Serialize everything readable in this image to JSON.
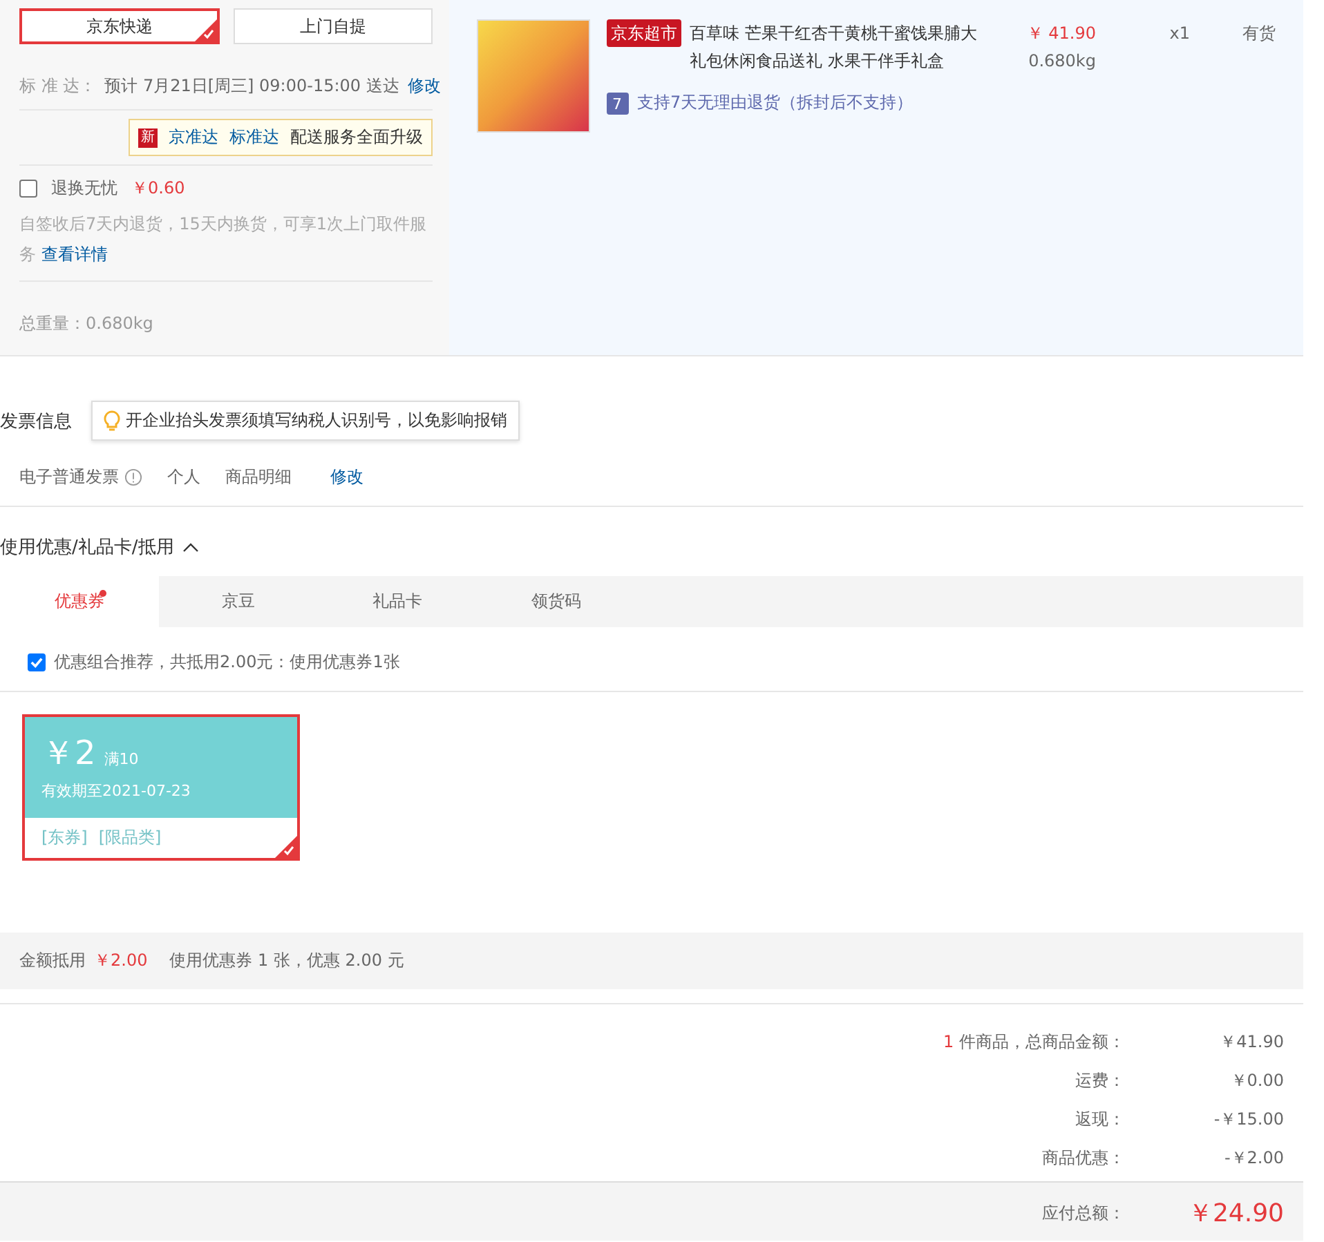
{
  "shipping": {
    "methods": [
      {
        "label": "京东快递",
        "selected": true
      },
      {
        "label": "上门自提",
        "selected": false
      }
    ],
    "delivery": {
      "label": "标 准 达：",
      "value": "预计 7月21日[周三] 09:00-15:00 送达",
      "action": "修改"
    },
    "promo": {
      "badge": "新",
      "links": [
        "京准达",
        "标准达"
      ],
      "text": "配送服务全面升级"
    },
    "addon": {
      "label": "退换无忧",
      "price": "￥0.60",
      "checked": false,
      "description": "自签收后7天内退货，15天内换货，可享1次上门取件服务",
      "link": "查看详情"
    },
    "weight": {
      "label": "总重量：",
      "value": "0.680kg"
    }
  },
  "product": {
    "tag": "京东超市",
    "title": "百草味 芒果干红杏干黄桃干蜜饯果脯大礼包休闲食品送礼 水果干伴手礼盒",
    "price": "￥ 41.90",
    "weight": "0.680kg",
    "quantity": "x1",
    "stock": "有货",
    "return_badge": "7",
    "return_policy": "支持7天无理由退货（拆封后不支持）"
  },
  "invoice": {
    "title": "发票信息",
    "tip": "开企业抬头发票须填写纳税人识别号，以免影响报销",
    "type": "电子普通发票",
    "holder": "个人",
    "content": "商品明细",
    "action": "修改"
  },
  "discounts": {
    "title": "使用优惠/礼品卡/抵用",
    "expanded": true,
    "tabs": [
      {
        "label": "优惠券",
        "selected": true,
        "dot": true
      },
      {
        "label": "京豆",
        "selected": false,
        "dot": false
      },
      {
        "label": "礼品卡",
        "selected": false,
        "dot": false
      },
      {
        "label": "领货码",
        "selected": false,
        "dot": false
      }
    ],
    "recommend": {
      "checked": true,
      "text": "优惠组合推荐，共抵用2.00元：使用优惠券1张"
    },
    "coupons": [
      {
        "amount": "￥2",
        "condition": "满10",
        "validity": "有效期至2021-07-23",
        "tags": [
          "[东券]",
          "[限品类]"
        ],
        "selected": true
      }
    ],
    "summary": {
      "label": "金额抵用",
      "amount": "￥2.00",
      "text": "使用优惠券 1 张，优惠 2.00 元"
    }
  },
  "totals": {
    "rows": [
      {
        "count": "1",
        "label": "件商品，总商品金额：",
        "value": "￥41.90"
      },
      {
        "label": "运费：",
        "value": "￥0.00"
      },
      {
        "label": "返现：",
        "value": "-￥15.00"
      },
      {
        "label": "商品优惠：",
        "value": "-￥2.00"
      }
    ],
    "payable": {
      "label": "应付总额：",
      "value": "￥24.90"
    }
  }
}
